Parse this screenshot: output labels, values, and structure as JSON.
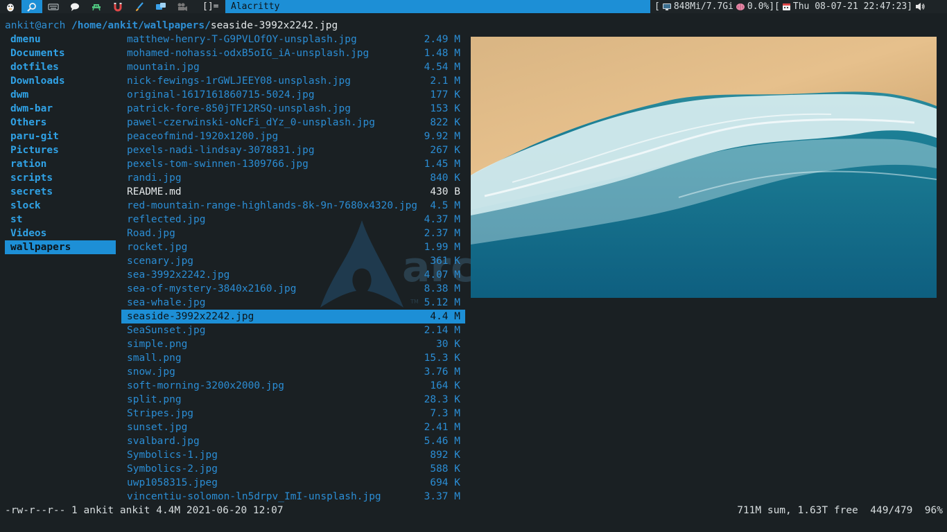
{
  "topbar": {
    "tags": [
      "pi-icon",
      "search-icon",
      "keyboard-icon",
      "chat-icon",
      "alien-icon",
      "magnet-icon",
      "brush-icon",
      "vm-icon",
      "camera-icon"
    ],
    "active_tag": 1,
    "layout_symbol": "[]=",
    "window_title": "Alacritty",
    "status": {
      "memory": "848Mi/7.7Gi",
      "cpu": "0.0%",
      "datetime": "Thu 08-07-21 22:47:23",
      "accent": "#1d8fd6"
    }
  },
  "terminal": {
    "user_host": "ankit@arch",
    "dir_path": "/home/ankit/wallpapers/",
    "current_file": "seaside-3992x2242.jpg",
    "parent_dirs": [
      "dmenu",
      "Documents",
      "dotfiles",
      "Downloads",
      "dwm",
      "dwm-bar",
      "Others",
      "paru-git",
      "Pictures",
      "ration",
      "scripts",
      "secrets",
      "slock",
      "st",
      "Videos",
      "wallpapers"
    ],
    "selected_parent": 15,
    "files": [
      {
        "name": "matthew-henry-T-G9PVLOfOY-unsplash.jpg",
        "size": "2.49 M"
      },
      {
        "name": "mohamed-nohassi-odxB5oIG_iA-unsplash.jpg",
        "size": "1.48 M"
      },
      {
        "name": "mountain.jpg",
        "size": "4.54 M"
      },
      {
        "name": "nick-fewings-1rGWLJEEY08-unsplash.jpg",
        "size": "2.1 M"
      },
      {
        "name": "original-1617161860715-5024.jpg",
        "size": "177 K"
      },
      {
        "name": "patrick-fore-850jTF12RSQ-unsplash.jpg",
        "size": "153 K"
      },
      {
        "name": "pawel-czerwinski-oNcFi_dYz_0-unsplash.jpg",
        "size": "822 K"
      },
      {
        "name": "peaceofmind-1920x1200.jpg",
        "size": "9.92 M"
      },
      {
        "name": "pexels-nadi-lindsay-3078831.jpg",
        "size": "267 K"
      },
      {
        "name": "pexels-tom-swinnen-1309766.jpg",
        "size": "1.45 M"
      },
      {
        "name": "randi.jpg",
        "size": "840 K"
      },
      {
        "name": "README.md",
        "size": "430 B",
        "plain": true
      },
      {
        "name": "red-mountain-range-highlands-8k-9n-7680x4320.jpg",
        "size": "4.5 M"
      },
      {
        "name": "reflected.jpg",
        "size": "4.37 M"
      },
      {
        "name": "Road.jpg",
        "size": "2.37 M"
      },
      {
        "name": "rocket.jpg",
        "size": "1.99 M"
      },
      {
        "name": "scenary.jpg",
        "size": "361 K"
      },
      {
        "name": "sea-3992x2242.jpg",
        "size": "4.07 M"
      },
      {
        "name": "sea-of-mystery-3840x2160.jpg",
        "size": "8.38 M"
      },
      {
        "name": "sea-whale.jpg",
        "size": "5.12 M"
      },
      {
        "name": "seaside-3992x2242.jpg",
        "size": "4.4 M"
      },
      {
        "name": "SeaSunset.jpg",
        "size": "2.14 M"
      },
      {
        "name": "simple.png",
        "size": "30 K"
      },
      {
        "name": "small.png",
        "size": "15.3 K"
      },
      {
        "name": "snow.jpg",
        "size": "3.76 M"
      },
      {
        "name": "soft-morning-3200x2000.jpg",
        "size": "164 K"
      },
      {
        "name": "split.png",
        "size": "28.3 K"
      },
      {
        "name": "Stripes.jpg",
        "size": "7.3 M"
      },
      {
        "name": "sunset.jpg",
        "size": "2.41 M"
      },
      {
        "name": "svalbard.jpg",
        "size": "5.46 M"
      },
      {
        "name": "Symbolics-1.jpg",
        "size": "892 K"
      },
      {
        "name": "Symbolics-2.jpg",
        "size": "588 K"
      },
      {
        "name": "uwp1058315.jpeg",
        "size": "694 K"
      },
      {
        "name": "vincentiu-solomon-ln5drpv_ImI-unsplash.jpg",
        "size": "3.37 M"
      }
    ],
    "selected_file": 20,
    "bottom_left": "-rw-r--r-- 1 ankit ankit 4.4M 2021-06-20 12:07",
    "bottom_right": "711M sum, 1.63T free  449/479  96%"
  }
}
